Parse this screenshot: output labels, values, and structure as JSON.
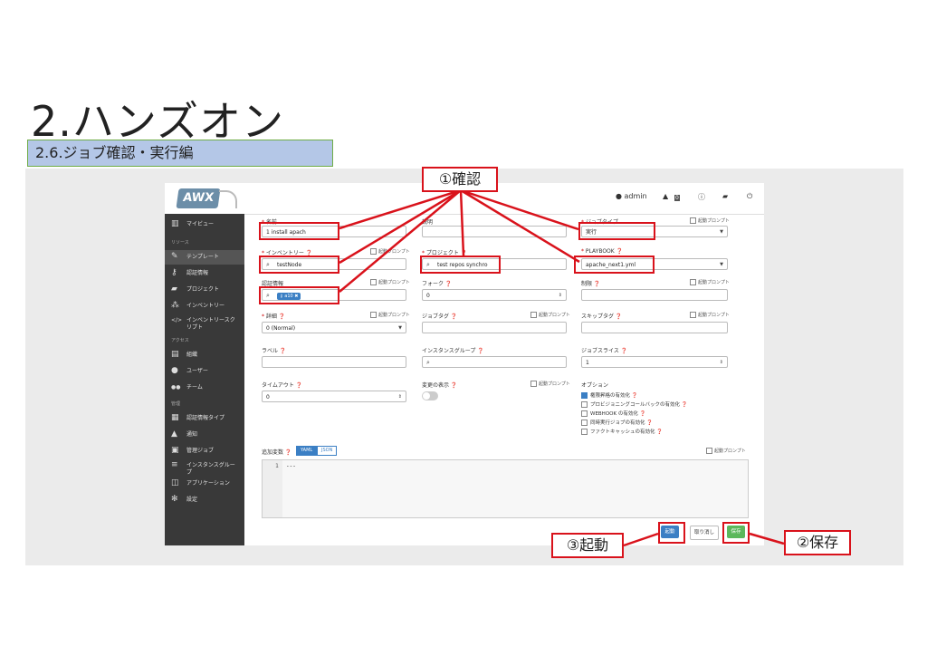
{
  "slide": {
    "title": "2.ハンズオン",
    "subtitle": "2.6.ジョブ確認・実行編"
  },
  "topbar": {
    "user": "admin",
    "badge": "0"
  },
  "sidebar": {
    "items": [
      {
        "icon": "▥",
        "label": "マイビュー"
      },
      {
        "section": "リソース"
      },
      {
        "icon": "✎",
        "label": "テンプレート"
      },
      {
        "icon": "⚷",
        "label": "認証情報"
      },
      {
        "icon": "▰",
        "label": "プロジェクト"
      },
      {
        "icon": "⁂",
        "label": "インベントリー"
      },
      {
        "icon": "</>",
        "label": "インベントリースク",
        "label2": "リプト"
      },
      {
        "section": "アクセス"
      },
      {
        "icon": "▤",
        "label": "組織"
      },
      {
        "icon": "●",
        "label": "ユーザー"
      },
      {
        "icon": "●●",
        "label": "チーム"
      },
      {
        "section": "管理"
      },
      {
        "icon": "▦",
        "label": "認証情報タイプ"
      },
      {
        "icon": "▲",
        "label": "通知"
      },
      {
        "icon": "▣",
        "label": "管理ジョブ"
      },
      {
        "icon": "≡",
        "label": "インスタンスグルー",
        "label2": "プ"
      },
      {
        "icon": "◫",
        "label": "アプリケーション"
      },
      {
        "icon": "✻",
        "label": "設定"
      }
    ]
  },
  "form": {
    "prompt_label": "起動プロンプト",
    "name": {
      "label": "名前",
      "value": "1 install apach"
    },
    "description": {
      "label": "説明",
      "value": ""
    },
    "job_type": {
      "label": "ジョブタイプ",
      "value": "実行"
    },
    "inventory": {
      "label": "インベントリー",
      "value": "testNode"
    },
    "project": {
      "label": "プロジェクト",
      "value": "test repos synchro"
    },
    "playbook": {
      "label": "PLAYBOOK",
      "value": "apache_next1.yml"
    },
    "credential": {
      "label": "認証情報",
      "chip": "a10"
    },
    "forks": {
      "label": "フォーク",
      "value": "0"
    },
    "limit": {
      "label": "制限",
      "value": ""
    },
    "verbosity": {
      "label": "詳細",
      "value": "0 (Normal)"
    },
    "job_tags": {
      "label": "ジョブタグ",
      "value": ""
    },
    "skip_tags": {
      "label": "スキップタグ",
      "value": ""
    },
    "labels": {
      "label": "ラベル",
      "value": ""
    },
    "instance_groups": {
      "label": "インスタンスグループ",
      "value": ""
    },
    "job_slicing": {
      "label": "ジョブスライス",
      "value": "1"
    },
    "timeout": {
      "label": "タイムアウト",
      "value": "0"
    },
    "show_changes": {
      "label": "変更の表示"
    },
    "options": {
      "label": "オプション",
      "items": [
        {
          "label": "権限昇格の有効化",
          "checked": true
        },
        {
          "label": "プロビジョニングコールバックの有効化",
          "checked": false
        },
        {
          "label": "WEBHOOK の有効化",
          "checked": false
        },
        {
          "label": "同時実行ジョブの有効化",
          "checked": false
        },
        {
          "label": "ファクトキャッシュの有効化",
          "checked": false
        }
      ]
    },
    "extra_vars": {
      "label": "追加変数",
      "tab_yaml": "YAML",
      "tab_json": "JSON",
      "line": "1",
      "code": "---"
    }
  },
  "buttons": {
    "launch": "起動",
    "cancel": "取り消し",
    "save": "保存"
  },
  "callouts": {
    "confirm": "①確認",
    "launch": "③起動",
    "save": "②保存"
  },
  "colors": {
    "annotation_red": "#d9121b",
    "launch_blue": "#3b7fc4",
    "save_green": "#5cb85c",
    "sidebar_dark": "#393939"
  }
}
